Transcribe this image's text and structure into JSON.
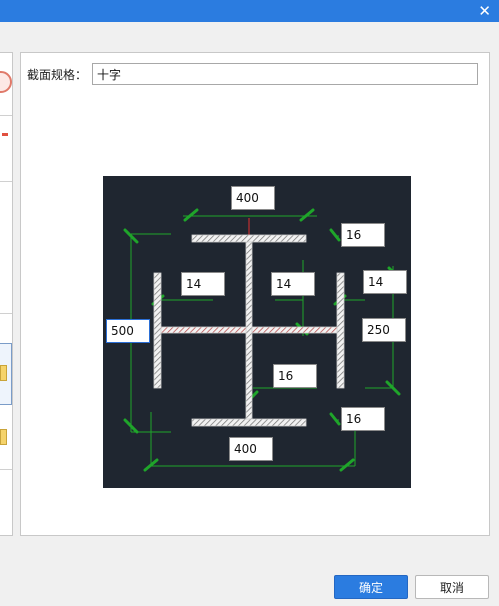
{
  "window": {
    "close_glyph": "✕"
  },
  "spec": {
    "label": "截面规格：",
    "value": "十字"
  },
  "dims": {
    "top_width": "400",
    "top_flange_thickness": "16",
    "left_web_thickness": "14",
    "center_web_thickness": "14",
    "right_web_thickness": "14",
    "overall_height": "500",
    "half_width": "250",
    "lower_web_thickness": "16",
    "bottom_flange_thickness": "16",
    "bottom_width": "400"
  },
  "buttons": {
    "ok": "确定",
    "cancel": "取消"
  },
  "colors": {
    "titlebar": "#2b7ce0",
    "canvas_bg": "#1f2630",
    "dimension_line": "#1fa52a",
    "center_line": "#e03030",
    "primary_button": "#2b7ce0"
  },
  "icons": {
    "close": "close-icon",
    "hatch": "hatched-steel-plate"
  }
}
